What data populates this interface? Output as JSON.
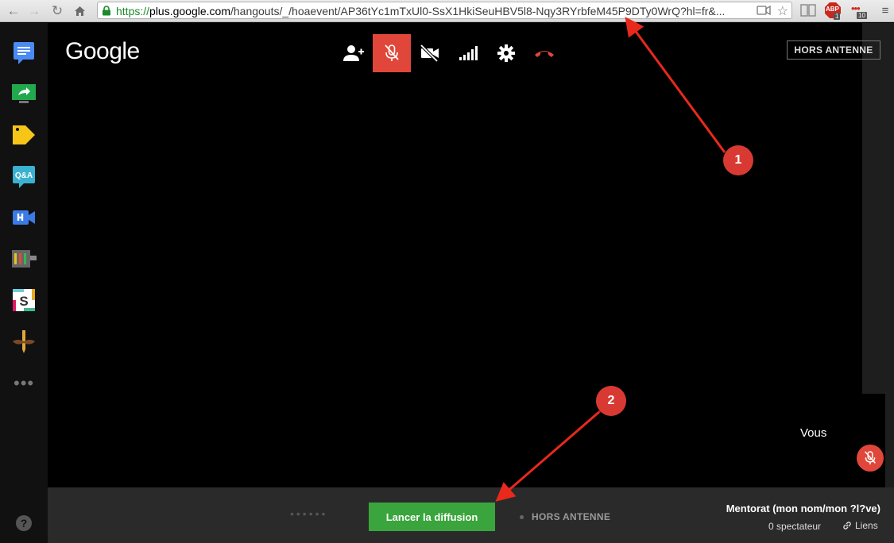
{
  "browser": {
    "url_scheme": "https://",
    "url_host": "plus.google.com",
    "url_path": "/hangouts/_/hoaevent/AP36tYc1mTxUl0-SsX1HkiSeuHBV5l8-Nqy3RYrbfeM45P9DTy0WrQ?hl=fr&...",
    "extensions": [
      {
        "name": "abp-icon",
        "label": "ABP",
        "badge": "1"
      },
      {
        "name": "ext-icon",
        "badge": "10"
      }
    ]
  },
  "header": {
    "logo": "Google",
    "status": "HORS ANTENNE"
  },
  "toolbar": {
    "buttons": [
      {
        "name": "invite-person-icon",
        "active": false
      },
      {
        "name": "mic-muted-icon",
        "active": true
      },
      {
        "name": "camera-off-icon",
        "active": false
      },
      {
        "name": "signal-icon",
        "active": false
      },
      {
        "name": "settings-icon",
        "active": false
      },
      {
        "name": "hang-up-icon",
        "active": false
      }
    ]
  },
  "self_view": {
    "label": "Vous"
  },
  "bottombar": {
    "start_button": "Lancer la diffusion",
    "status": "HORS ANTENNE",
    "event_title": "Mentorat (mon nom/mon ?l?ve)",
    "viewers": "0 spectateur",
    "links": "Liens"
  },
  "annotations": [
    {
      "label": "1"
    },
    {
      "label": "2"
    }
  ],
  "colors": {
    "accent_red": "#e0473a",
    "start_green": "#3aa53c",
    "annotation_red": "#d83a33"
  }
}
